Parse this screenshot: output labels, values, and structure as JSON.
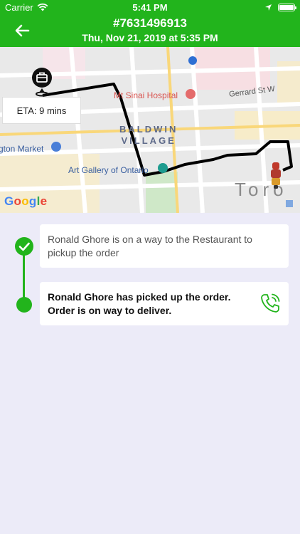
{
  "status_bar": {
    "carrier": "Carrier",
    "time": "5:41 PM"
  },
  "header": {
    "order_id": "#7631496913",
    "order_datetime": "Thu, Nov 21, 2019 at 5:35 PM",
    "back_icon": "back-arrow-icon"
  },
  "map": {
    "eta": "ETA: 9 mins",
    "labels": {
      "hospital": "Mt Sinai Hospital",
      "street": "Gerrard St W",
      "neighborhood_line1": "BALDWIN",
      "neighborhood_line2": "VILLAGE",
      "market": "gton Market",
      "gallery": "Art Gallery of Ontario",
      "city": "Toro"
    },
    "attribution": [
      "G",
      "o",
      "o",
      "g",
      "l",
      "e"
    ]
  },
  "timeline": [
    {
      "text": "Ronald Ghore is on a way to the Restaurant to pickup the order",
      "completed": true
    },
    {
      "text": "Ronald Ghore has picked up the order. Order is on way to deliver.",
      "completed": false,
      "action_icon": "phone-call-icon"
    }
  ],
  "colors": {
    "brand_green": "#22b41c",
    "background": "#ecebf8"
  }
}
